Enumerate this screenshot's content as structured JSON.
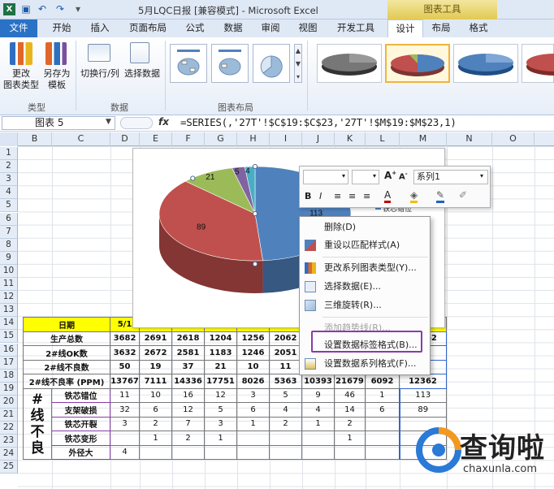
{
  "window": {
    "title": "5月LQC日报 [兼容模式] - Microsoft Excel",
    "chart_tools": "图表工具"
  },
  "tabs": [
    {
      "label": "文件"
    },
    {
      "label": "开始"
    },
    {
      "label": "插入"
    },
    {
      "label": "页面布局"
    },
    {
      "label": "公式"
    },
    {
      "label": "数据"
    },
    {
      "label": "审阅"
    },
    {
      "label": "视图"
    },
    {
      "label": "开发工具"
    },
    {
      "label": "设计"
    },
    {
      "label": "布局"
    },
    {
      "label": "格式"
    }
  ],
  "ribbon": {
    "btn_change_type": "更改\n图表类型",
    "btn_save_template": "另存为\n模板",
    "btn_switch": "切换行/列",
    "btn_select_data": "选择数据",
    "group_type": "类型",
    "group_data": "数据",
    "group_layout": "图表布局"
  },
  "formula_bar": {
    "name_box": "图表 5",
    "fx": "fx",
    "formula": "=SERIES(,'27T'!$C$19:$C$23,'27T'!$M$19:$M$23,1)"
  },
  "columns": [
    "B",
    "C",
    "D",
    "E",
    "F",
    "G",
    "H",
    "I",
    "J",
    "K",
    "L",
    "M",
    "N",
    "O"
  ],
  "rows": [
    "1",
    "2",
    "3",
    "4",
    "5",
    "6",
    "7",
    "8",
    "9",
    "10",
    "11",
    "12",
    "13",
    "14",
    "15",
    "16",
    "17",
    "18",
    "19",
    "20",
    "21",
    "22",
    "23",
    "24",
    "25"
  ],
  "sheet": {
    "header_label": "日期",
    "header_d": "5/1",
    "rows": [
      {
        "label": "生产总数",
        "values": [
          "3682",
          "2691",
          "2618",
          "1204",
          "1256",
          "2062",
          "",
          "",
          "",
          "12362"
        ]
      },
      {
        "label": "2#线OK数",
        "values": [
          "3632",
          "2672",
          "2581",
          "1183",
          "1246",
          "2051",
          "",
          "",
          "",
          ""
        ]
      },
      {
        "label": "2#线不良数",
        "values": [
          "50",
          "19",
          "37",
          "21",
          "10",
          "11",
          "",
          "",
          "",
          ""
        ]
      },
      {
        "label": "2#线不良率 (PPM)",
        "values": [
          "13767",
          "7111",
          "14336",
          "17751",
          "8026",
          "5363",
          "10393",
          "21679",
          "6092",
          "12362"
        ]
      }
    ],
    "side_label": "#\n线\n不\n良",
    "defects": [
      {
        "label": "铁芯错位",
        "values": [
          "11",
          "10",
          "16",
          "12",
          "3",
          "5",
          "9",
          "46",
          "1",
          "113"
        ]
      },
      {
        "label": "支架破损",
        "values": [
          "32",
          "6",
          "12",
          "5",
          "6",
          "4",
          "4",
          "14",
          "6",
          "89"
        ]
      },
      {
        "label": "铁芯开裂",
        "values": [
          "3",
          "2",
          "7",
          "3",
          "1",
          "2",
          "1",
          "2",
          "",
          ""
        ]
      },
      {
        "label": "铁芯变形",
        "values": [
          "",
          "1",
          "2",
          "1",
          "",
          "",
          "",
          "1",
          "",
          ""
        ]
      },
      {
        "label": "外径大",
        "values": [
          "4",
          "",
          "",
          "",
          "",
          "",
          "",
          "",
          "",
          ""
        ]
      }
    ]
  },
  "chart_data": {
    "type": "pie",
    "values": [
      113,
      89,
      21,
      5,
      4
    ],
    "labels": [
      "113",
      "89",
      "21",
      "5",
      "4"
    ],
    "colors": [
      "#4f81bd",
      "#c0504d",
      "#9bbb59",
      "#8064a2",
      "#4bacc6"
    ],
    "legend_partial": "铁芯错位"
  },
  "mini_toolbar": {
    "series_select": "系列1"
  },
  "context_menu": [
    {
      "label": "删除(D)",
      "disabled": false
    },
    {
      "label": "重设以匹配样式(A)",
      "disabled": false
    },
    {
      "label": "更改系列图表类型(Y)...",
      "disabled": false
    },
    {
      "label": "选择数据(E)...",
      "disabled": false
    },
    {
      "label": "三维旋转(R)...",
      "disabled": false
    },
    {
      "label": "添加趋势线(R)...",
      "disabled": true
    },
    {
      "label": "设置数据标签格式(B)...",
      "disabled": false
    },
    {
      "label": "设置数据系列格式(F)...",
      "disabled": false
    }
  ],
  "watermark": {
    "brand": "查询啦",
    "url": "chaxunla.com"
  }
}
